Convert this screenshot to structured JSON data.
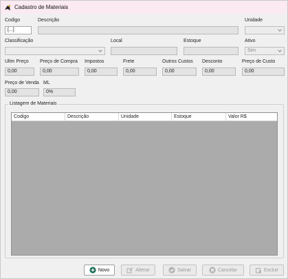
{
  "window": {
    "title": "Cadastro de Materiais"
  },
  "form": {
    "codigo_label": "Codigo",
    "codigo_value": "[...]",
    "descricao_label": "Descrição",
    "descricao_value": "",
    "unidade_label": "Unidade",
    "unidade_value": "",
    "classificacao_label": "Classificação",
    "classificacao_value": "",
    "local_label": "Local",
    "local_value": "",
    "estoque_label": "Estoque",
    "estoque_value": "",
    "ativo_label": "Ativo",
    "ativo_value": "Sim",
    "ultm_preco_label": "Ultm Preço",
    "ultm_preco_value": "0,00",
    "preco_compra_label": "Preço de Compra",
    "preco_compra_value": "0,00",
    "impostos_label": "Impostos",
    "impostos_value": "0,00",
    "frete_label": "Frete",
    "frete_value": "0,00",
    "outros_custos_label": "Outros Custos",
    "outros_custos_value": "0,00",
    "desconto_label": "Desconto",
    "desconto_value": "0,00",
    "preco_custo_label": "Preço de Custo",
    "preco_custo_value": "0,00",
    "preco_venda_label": "Preço de Venda",
    "preco_venda_value": "0,00",
    "ml_label": "ML",
    "ml_value": "0%"
  },
  "listing": {
    "title": "Listagem de Materiais",
    "columns": [
      "Codigo",
      "Descrição",
      "Unidade",
      "Estoque",
      "Valor R$"
    ]
  },
  "buttons": {
    "novo": "Novo",
    "alterar": "Alterar",
    "salvar": "Salvar",
    "cancelar": "Cancelar",
    "excluir": "Excluir"
  },
  "colors": {
    "titlebar": "#fbeaf2",
    "window_bg": "#f0f0f0",
    "grid_bg": "#ababab",
    "novo_icon": "#1f6e5a"
  }
}
